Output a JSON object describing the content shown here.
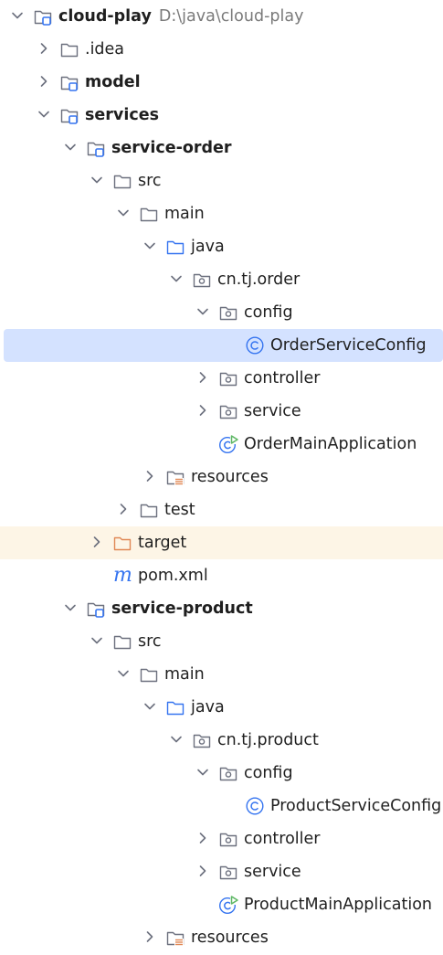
{
  "tree": [
    {
      "label": "cloud-play",
      "path": "D:\\java\\cloud-play",
      "icon": "module-folder",
      "chevron": "down",
      "depth": 0,
      "bold": true
    },
    {
      "label": ".idea",
      "icon": "folder",
      "chevron": "right",
      "depth": 1
    },
    {
      "label": "model",
      "icon": "module-folder",
      "chevron": "right",
      "depth": 1,
      "bold": true
    },
    {
      "label": "services",
      "icon": "module-folder",
      "chevron": "down",
      "depth": 1,
      "bold": true
    },
    {
      "label": "service-order",
      "icon": "module-folder",
      "chevron": "down",
      "depth": 2,
      "bold": true
    },
    {
      "label": "src",
      "icon": "folder",
      "chevron": "down",
      "depth": 3
    },
    {
      "label": "main",
      "icon": "folder",
      "chevron": "down",
      "depth": 4
    },
    {
      "label": "java",
      "icon": "source-folder",
      "chevron": "down",
      "depth": 5
    },
    {
      "label": "cn.tj.order",
      "icon": "package",
      "chevron": "down",
      "depth": 6
    },
    {
      "label": "config",
      "icon": "package",
      "chevron": "down",
      "depth": 7
    },
    {
      "label": "OrderServiceConfig",
      "icon": "class",
      "chevron": "none",
      "depth": 8,
      "selected": true
    },
    {
      "label": "controller",
      "icon": "package",
      "chevron": "right",
      "depth": 7
    },
    {
      "label": "service",
      "icon": "package",
      "chevron": "right",
      "depth": 7
    },
    {
      "label": "OrderMainApplication",
      "icon": "run-class",
      "chevron": "none",
      "depth": 7
    },
    {
      "label": "resources",
      "icon": "resources-folder",
      "chevron": "right",
      "depth": 5
    },
    {
      "label": "test",
      "icon": "folder",
      "chevron": "right",
      "depth": 4
    },
    {
      "label": "target",
      "icon": "excluded-folder",
      "chevron": "right",
      "depth": 3,
      "highlighted": true
    },
    {
      "label": "pom.xml",
      "icon": "maven",
      "chevron": "none",
      "depth": 3
    },
    {
      "label": "service-product",
      "icon": "module-folder",
      "chevron": "down",
      "depth": 2,
      "bold": true
    },
    {
      "label": "src",
      "icon": "folder",
      "chevron": "down",
      "depth": 3
    },
    {
      "label": "main",
      "icon": "folder",
      "chevron": "down",
      "depth": 4
    },
    {
      "label": "java",
      "icon": "source-folder",
      "chevron": "down",
      "depth": 5
    },
    {
      "label": "cn.tj.product",
      "icon": "package",
      "chevron": "down",
      "depth": 6
    },
    {
      "label": "config",
      "icon": "package",
      "chevron": "down",
      "depth": 7
    },
    {
      "label": "ProductServiceConfig",
      "icon": "class",
      "chevron": "none",
      "depth": 8
    },
    {
      "label": "controller",
      "icon": "package",
      "chevron": "right",
      "depth": 7
    },
    {
      "label": "service",
      "icon": "package",
      "chevron": "right",
      "depth": 7
    },
    {
      "label": "ProductMainApplication",
      "icon": "run-class",
      "chevron": "none",
      "depth": 7
    },
    {
      "label": "resources",
      "icon": "resources-folder",
      "chevron": "right",
      "depth": 5
    }
  ],
  "colors": {
    "selection": "#d4e2ff",
    "highlight": "#fdf5e6",
    "folder_stroke": "#6c707e",
    "module_badge": "#3574f0",
    "source_stroke": "#3574f0",
    "excluded_stroke": "#e08855",
    "class_stroke": "#3574f0",
    "run_green": "#5fb865",
    "resources_bars": "#e08855",
    "path_text": "#7a7a7a"
  }
}
